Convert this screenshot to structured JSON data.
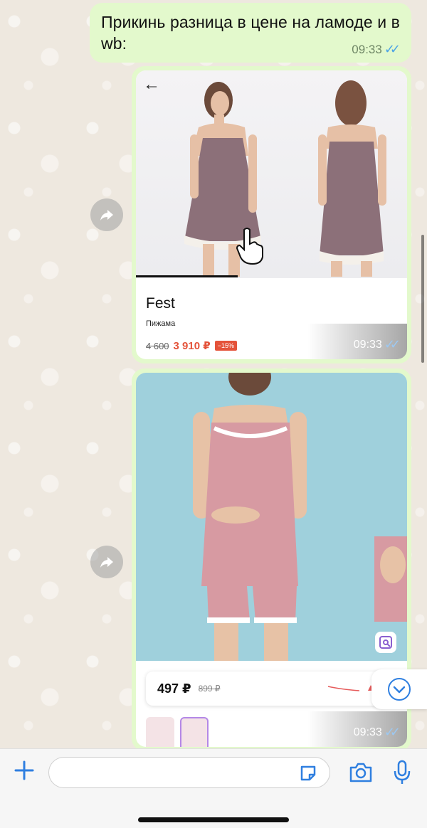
{
  "message_text": {
    "text": "Прикинь разница в цене на ламоде и в wb:",
    "time": "09:33"
  },
  "lamoda_card": {
    "brand": "Fest",
    "category": "Пижама",
    "old_price": "4 600",
    "new_price": "3 910 ₽",
    "discount": "−15%",
    "time": "09:33"
  },
  "wb_card": {
    "price": "497 ₽",
    "old_price": "899 ₽",
    "time": "09:33"
  },
  "colors": {
    "bubble": "#e3f9cc",
    "check": "#4aa3e6",
    "accent": "#2f7fe0",
    "discount": "#e4533a"
  },
  "icons": [
    "back-arrow-icon",
    "forward-icon",
    "chevron-down-icon",
    "plus-icon",
    "sticker-icon",
    "camera-icon",
    "mic-icon",
    "visual-search-icon"
  ]
}
